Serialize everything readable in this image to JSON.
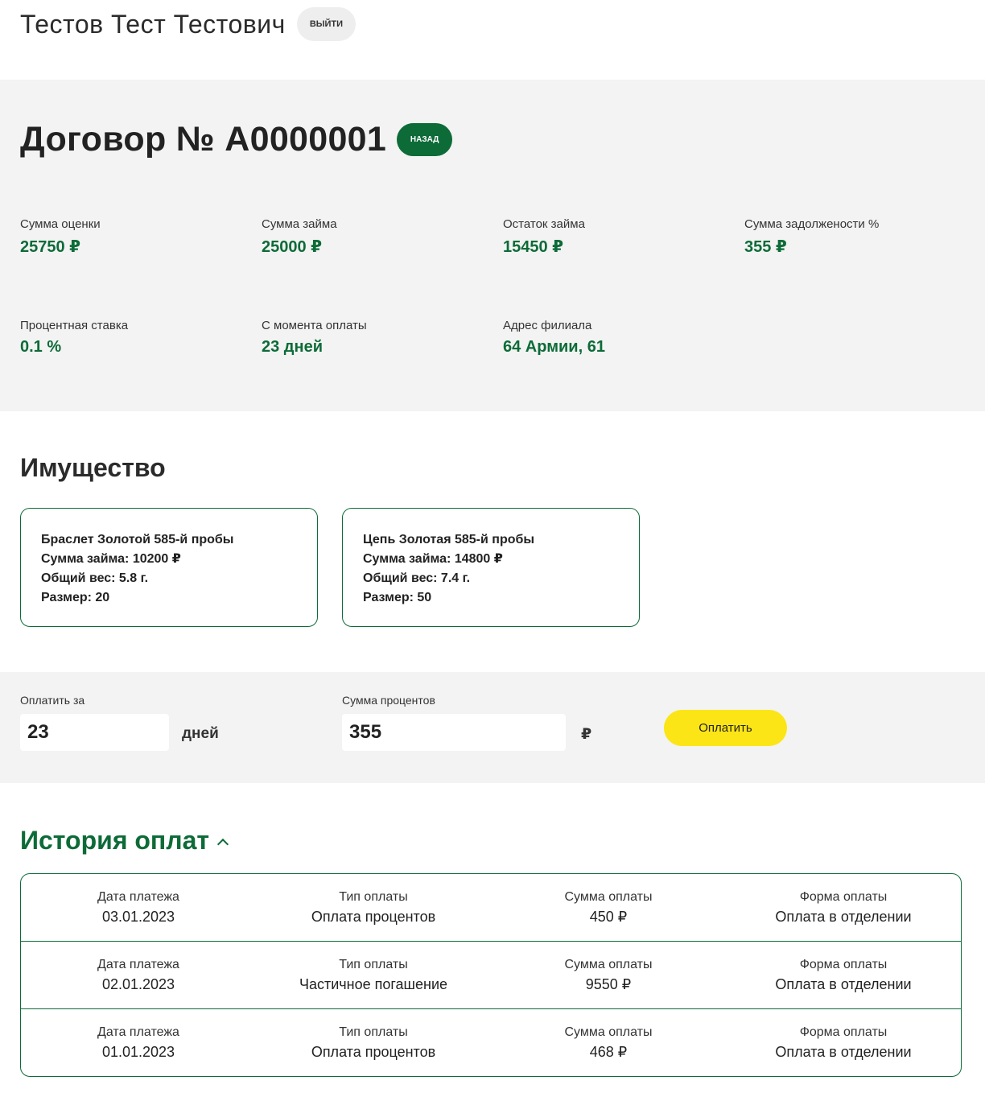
{
  "header": {
    "user_name": "Тестов Тест Тестович",
    "logout_label": "ВЫЙТИ"
  },
  "contract": {
    "title": "Договор № А0000001",
    "back_label": "НАЗАД",
    "stats": [
      {
        "label": "Сумма оценки",
        "value": "25750 ₽"
      },
      {
        "label": "Сумма займа",
        "value": "25000 ₽"
      },
      {
        "label": "Остаток займа",
        "value": "15450 ₽"
      },
      {
        "label": "Сумма задолжености %",
        "value": "355 ₽"
      },
      {
        "label": "Процентная ставка",
        "value": "0.1 %"
      },
      {
        "label": "С момента оплаты",
        "value": "23 дней"
      },
      {
        "label": "Адрес филиала",
        "value": "64 Армии, 61"
      }
    ]
  },
  "property": {
    "title": "Имущество",
    "items": [
      {
        "name": "Браслет Золотой 585-й пробы",
        "loan": "Сумма займа: 10200 ₽",
        "weight": "Общий вес: 5.8 г.",
        "size": "Размер: 20"
      },
      {
        "name": "Цепь Золотая 585-й пробы",
        "loan": "Сумма займа: 14800 ₽",
        "weight": "Общий вес: 7.4 г.",
        "size": "Размер: 50"
      }
    ]
  },
  "payment": {
    "days_label": "Оплатить за",
    "days_value": "23",
    "days_unit": "дней",
    "interest_label": "Сумма процентов",
    "interest_value": "355",
    "currency": "₽",
    "pay_label": "Оплатить"
  },
  "history": {
    "title": "История оплат",
    "rows": [
      {
        "date_label": "Дата платежа",
        "date": "03.01.2023",
        "type_label": "Тип оплаты",
        "type": "Оплата процентов",
        "sum_label": "Сумма оплаты",
        "sum": "450 ₽",
        "form_label": "Форма оплаты",
        "form": "Оплата в отделении"
      },
      {
        "date_label": "Дата платежа",
        "date": "02.01.2023",
        "type_label": "Тип оплаты",
        "type": "Частичное погашение",
        "sum_label": "Сумма оплаты",
        "sum": "9550 ₽",
        "form_label": "Форма оплаты",
        "form": "Оплата в отделении"
      },
      {
        "date_label": "Дата платежа",
        "date": "01.01.2023",
        "type_label": "Тип оплаты",
        "type": "Оплата процентов",
        "sum_label": "Сумма оплаты",
        "sum": "468 ₽",
        "form_label": "Форма оплаты",
        "form": "Оплата в отделении"
      }
    ]
  },
  "colors": {
    "accent_green": "#0d6b38",
    "pay_button_yellow": "#fbe516",
    "panel_gray": "#f3f3f3"
  }
}
